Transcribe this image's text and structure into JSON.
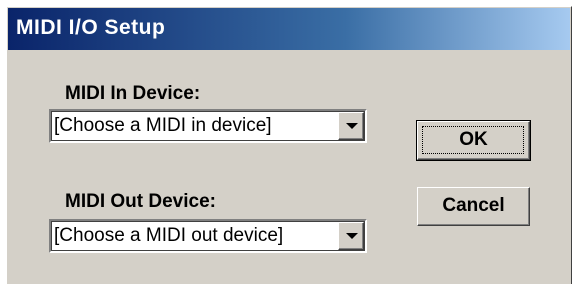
{
  "window": {
    "title": "MIDI I/O Setup"
  },
  "midi_in": {
    "label": "MIDI In Device:",
    "selected": "[Choose a MIDI in device]"
  },
  "midi_out": {
    "label": "MIDI Out Device:",
    "selected": "[Choose a MIDI out device]"
  },
  "buttons": {
    "ok_label": "OK",
    "cancel_label": "Cancel"
  },
  "icons": {
    "dropdown_arrow": "chevron-down-icon"
  },
  "colors": {
    "dialog_face": "#d4d0c8",
    "titlebar_start": "#0a246a",
    "titlebar_end": "#a6caf0"
  }
}
